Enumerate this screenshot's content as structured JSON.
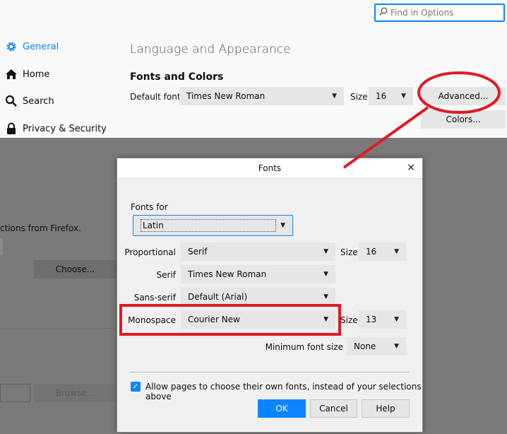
{
  "search": {
    "placeholder": "Find in Options",
    "icon": "search-icon"
  },
  "sidebar": {
    "items": [
      {
        "label": "General",
        "icon": "gear-icon",
        "active": true
      },
      {
        "label": "Home",
        "icon": "home-icon"
      },
      {
        "label": "Search",
        "icon": "search-icon"
      },
      {
        "label": "Privacy & Security",
        "icon": "lock-icon"
      }
    ]
  },
  "main": {
    "section_title": "Language and Appearance",
    "fonts_colors_heading": "Fonts and Colors",
    "default_font_label": "Default font",
    "default_font_value": "Times New Roman",
    "size_label": "Size",
    "size_value": "16",
    "advanced_button": "Advanced...",
    "colors_button": "Colors..."
  },
  "background": {
    "partial_text": "ctions from Firefox.",
    "choose_button": "Choose...",
    "browse_button": "Browse..."
  },
  "dialog": {
    "title": "Fonts",
    "close": "×",
    "fonts_for_label": "Fonts for",
    "fonts_for_value": "Latin",
    "proportional_label": "Proportional",
    "proportional_value": "Serif",
    "proportional_size_label": "Size",
    "proportional_size_value": "16",
    "serif_label": "Serif",
    "serif_value": "Times New Roman",
    "sans_serif_label": "Sans-serif",
    "sans_serif_value": "Default (Arial)",
    "monospace_label": "Monospace",
    "monospace_value": "Courier New",
    "monospace_size_label": "Size",
    "monospace_size_value": "13",
    "min_font_size_label": "Minimum font size",
    "min_font_size_value": "None",
    "allow_pages_label": "Allow pages to choose their own fonts, instead of your selections above",
    "allow_pages_checked": true,
    "ok_button": "OK",
    "cancel_button": "Cancel",
    "help_button": "Help"
  },
  "colors": {
    "accent": "#0a84ff",
    "annotation": "#e01b24",
    "overlay": "#7a7a7a"
  }
}
